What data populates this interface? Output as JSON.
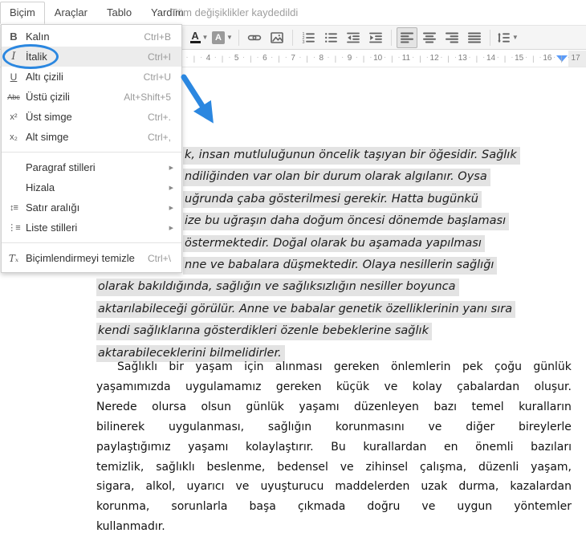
{
  "menubar": {
    "items": [
      {
        "label": "Biçim",
        "active": true
      },
      {
        "label": "Araçlar",
        "active": false
      },
      {
        "label": "Tablo",
        "active": false
      },
      {
        "label": "Yardım",
        "active": false
      }
    ],
    "status": "Tüm değişiklikler kaydedildi"
  },
  "format_menu": {
    "items": [
      {
        "label": "Kalın",
        "shortcut": "Ctrl+B",
        "icon": "bold-icon",
        "glyph": "B",
        "icon_class": "bold"
      },
      {
        "label": "İtalik",
        "shortcut": "Ctrl+I",
        "icon": "italic-icon",
        "glyph": "I",
        "icon_class": "italic",
        "highlighted": true,
        "annotated": "blue ellipse"
      },
      {
        "label": "Altı çizili",
        "shortcut": "Ctrl+U",
        "icon": "underline-icon",
        "glyph": "U",
        "icon_class": "underline"
      },
      {
        "label": "Üstü çizili",
        "shortcut": "Alt+Shift+5",
        "icon": "strikethrough-icon",
        "glyph": "Abc",
        "icon_class": "strike"
      },
      {
        "label": "Üst simge",
        "shortcut": "Ctrl+.",
        "icon": "superscript-icon",
        "glyph": "x²",
        "icon_class": "script"
      },
      {
        "label": "Alt simge",
        "shortcut": "Ctrl+,",
        "icon": "subscript-icon",
        "glyph": "x₂",
        "icon_class": "script"
      },
      {
        "type": "separator"
      },
      {
        "label": "Paragraf stilleri",
        "submenu": true
      },
      {
        "label": "Hizala",
        "submenu": true
      },
      {
        "label": "Satır aralığı",
        "submenu": true,
        "icon": "line-spacing-icon",
        "glyph": "↕≡",
        "icon_class": "lnsp"
      },
      {
        "label": "Liste stilleri",
        "submenu": true,
        "icon": "list-styles-icon",
        "glyph": "⋮≡",
        "icon_class": "lstst"
      },
      {
        "type": "separator"
      },
      {
        "label": "Biçimlendirmeyi temizle",
        "shortcut": "Ctrl+\\",
        "icon": "clear-formatting-icon",
        "glyph": "Tₓ",
        "icon_class": "clearfmt"
      }
    ]
  },
  "toolbar": {
    "buttons": [
      {
        "name": "text-color",
        "glyph": "A",
        "caret": true
      },
      {
        "name": "highlight-color",
        "glyph": "A",
        "caret": true
      },
      {
        "name": "sep"
      },
      {
        "name": "insert-link"
      },
      {
        "name": "insert-image"
      },
      {
        "name": "sep"
      },
      {
        "name": "numbered-list"
      },
      {
        "name": "bulleted-list"
      },
      {
        "name": "decrease-indent"
      },
      {
        "name": "increase-indent"
      },
      {
        "name": "sep"
      },
      {
        "name": "align-left",
        "active": true
      },
      {
        "name": "align-center"
      },
      {
        "name": "align-right"
      },
      {
        "name": "align-justify"
      },
      {
        "name": "sep"
      },
      {
        "name": "line-spacing",
        "caret": true
      }
    ]
  },
  "ruler": {
    "numbers": [
      "4",
      "5",
      "6",
      "7",
      "8",
      "9",
      "10",
      "11",
      "12",
      "13",
      "14",
      "15",
      "16",
      "17"
    ]
  },
  "document": {
    "selected_paragraph": {
      "style": "italic, selected with gray highlight",
      "lines": [
        {
          "text": "k, insan mutluluğunun öncelik taşıyan bir öğesidir. Sağlık",
          "covered_left": true
        },
        {
          "text": "ndiliğinden var olan bir durum olarak algılanır. Oysa",
          "covered_left": true
        },
        {
          "text": "uğrunda çaba gösterilmesi gerekir. Hatta bugünkü",
          "covered_left": true
        },
        {
          "text": "ize bu uğraşın daha doğum öncesi dönemde başlaması",
          "covered_left": true
        },
        {
          "text": "östermektedir. Doğal olarak bu aşamada yapılması",
          "covered_left": true
        },
        {
          "text": "nne ve babalara düşmektedir. Olaya nesillerin sağlığı",
          "covered_left": true
        },
        {
          "text": "olarak bakıldığında, sağlığın ve sağlıksızlığın nesiller boyunca",
          "covered_left": false
        },
        {
          "text": "aktarılabileceği görülür. Anne ve babalar genetik özelliklerinin yanı sıra",
          "covered_left": false
        },
        {
          "text": "kendi sağlıklarına gösterdikleri özenle bebeklerine sağlık",
          "covered_left": false
        },
        {
          "text": "aktarabileceklerini bilmelidirler.",
          "covered_left": false
        }
      ]
    },
    "second_paragraph": {
      "style": "regular, justified, first line indented",
      "lines": [
        "Sağlıklı bir yaşam için alınması gereken önlemlerin pek çoğu günlük",
        "yaşamımızda uygulamamız gereken küçük ve kolay çabalardan oluşur.",
        "Nerede olursa olsun günlük yaşamı düzenleyen bazı temel kuralların",
        "bilinerek uygulanması, sağlığın korunmasını ve diğer bireylerle",
        "paylaştığımız yaşamı kolaylaştırır. Bu kurallardan en önemli bazıları",
        "temizlik, sağlıklı beslenme, bedensel ve zihinsel çalışma, düzenli yaşam,",
        "sigara, alkol, uyarıcı ve uyuşturucu maddelerden uzak durma, kazalardan",
        "korunma, sorunlarla başa çıkmada doğru ve uygun yöntemler",
        "kullanmadır."
      ]
    }
  },
  "annotations": {
    "circle": {
      "target": "İtalik menu item"
    },
    "arrow": {
      "direction": "down-right, pointing into selected paragraph"
    }
  },
  "colors": {
    "annotation_blue": "#2b87e0",
    "selection_gray": "#e3e3e3",
    "toolbar_bg": "#f5f5f5",
    "ruler_indent_marker_blue": "#5b9bf8"
  }
}
